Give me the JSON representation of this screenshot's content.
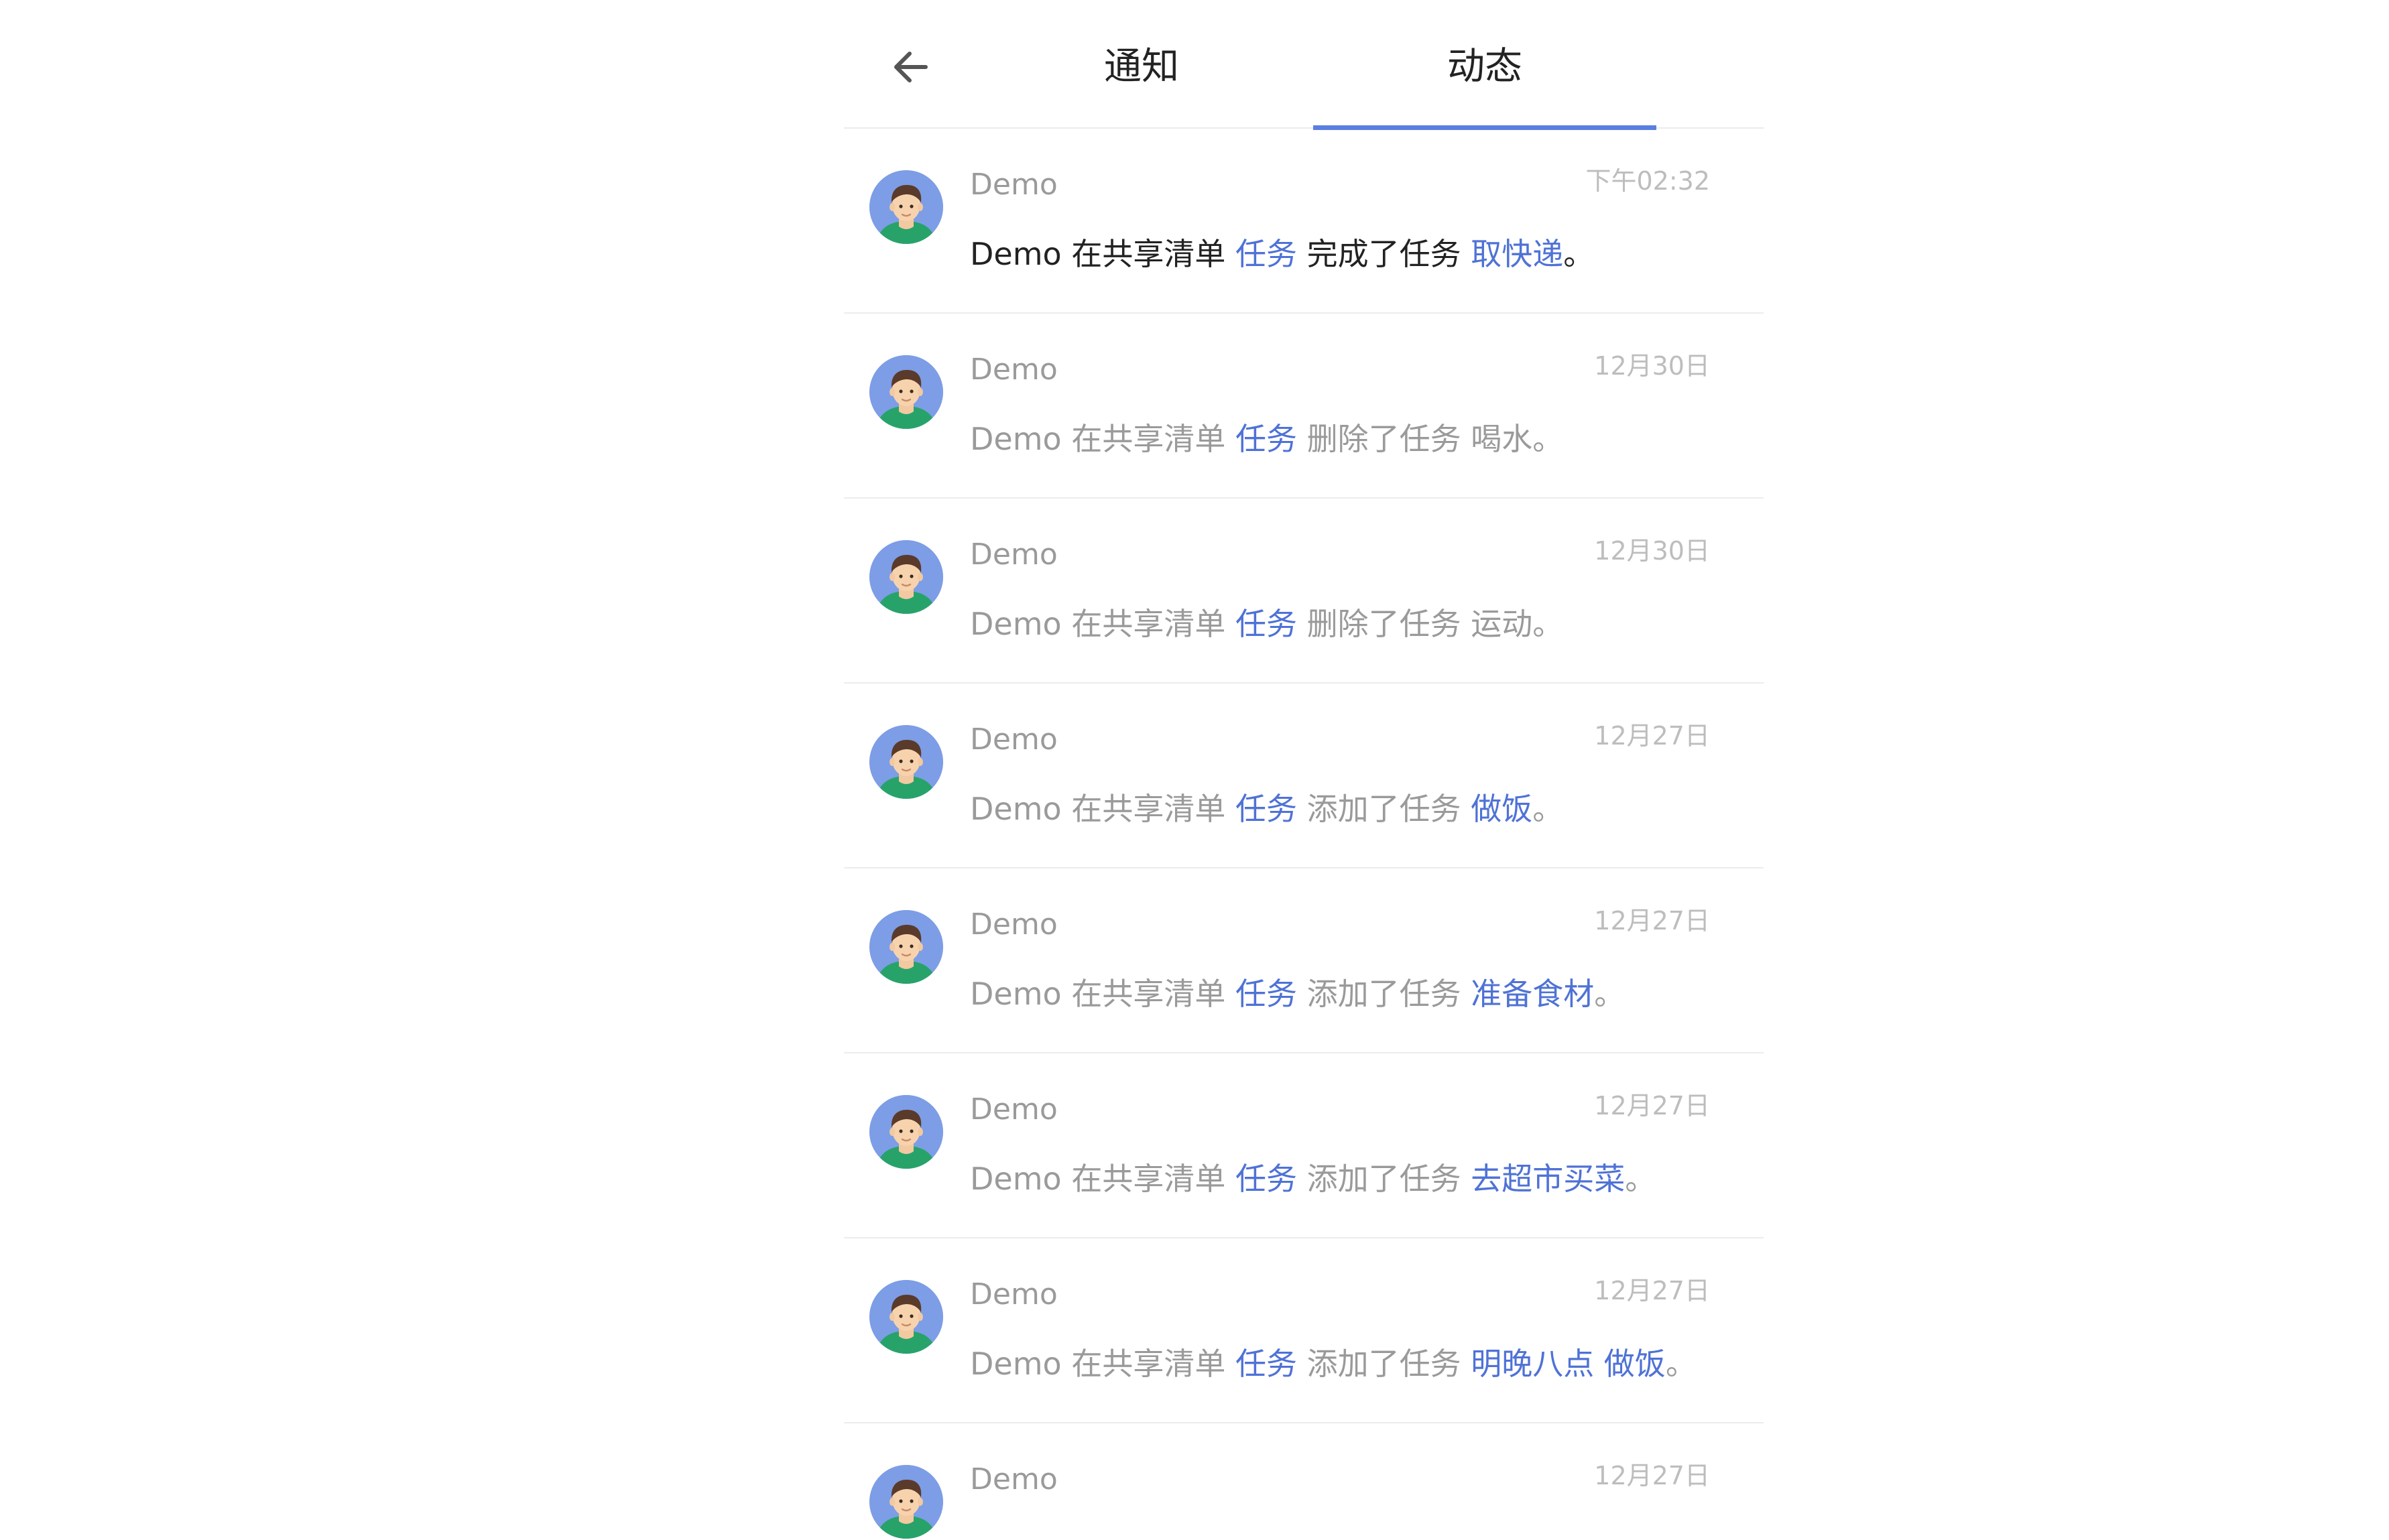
{
  "header": {
    "back_icon": "arrow-left-icon",
    "tabs": [
      {
        "label": "通知",
        "active": false
      },
      {
        "label": "动态",
        "active": true
      }
    ],
    "accent_color": "#5b7fe0"
  },
  "feed": {
    "items": [
      {
        "author": "Demo",
        "time": "下午02:32",
        "actor": "Demo",
        "in_list": "在共享清单",
        "list": "任务",
        "action": "完成了任务",
        "task": "取快递",
        "task_linked": true,
        "end": "。",
        "unread": true
      },
      {
        "author": "Demo",
        "time": "12月30日",
        "actor": "Demo",
        "in_list": "在共享清单",
        "list": "任务",
        "action": "删除了任务",
        "task": "喝水",
        "task_linked": false,
        "end": "。",
        "unread": false
      },
      {
        "author": "Demo",
        "time": "12月30日",
        "actor": "Demo",
        "in_list": "在共享清单",
        "list": "任务",
        "action": "删除了任务",
        "task": "运动",
        "task_linked": false,
        "end": "。",
        "unread": false
      },
      {
        "author": "Demo",
        "time": "12月27日",
        "actor": "Demo",
        "in_list": "在共享清单",
        "list": "任务",
        "action": "添加了任务",
        "task": "做饭",
        "task_linked": true,
        "end": "。",
        "unread": false
      },
      {
        "author": "Demo",
        "time": "12月27日",
        "actor": "Demo",
        "in_list": "在共享清单",
        "list": "任务",
        "action": "添加了任务",
        "task": "准备食材",
        "task_linked": true,
        "end": "。",
        "unread": false
      },
      {
        "author": "Demo",
        "time": "12月27日",
        "actor": "Demo",
        "in_list": "在共享清单",
        "list": "任务",
        "action": "添加了任务",
        "task": "去超市买菜",
        "task_linked": true,
        "end": "。",
        "unread": false
      },
      {
        "author": "Demo",
        "time": "12月27日",
        "actor": "Demo",
        "in_list": "在共享清单",
        "list": "任务",
        "action": "添加了任务",
        "task": "明晚八点 做饭",
        "task_linked": true,
        "end": "。",
        "unread": false
      },
      {
        "author": "Demo",
        "time": "12月27日",
        "actor": "",
        "in_list": "",
        "list": "",
        "action": "",
        "task": "",
        "task_linked": false,
        "end": "",
        "unread": false
      }
    ]
  }
}
